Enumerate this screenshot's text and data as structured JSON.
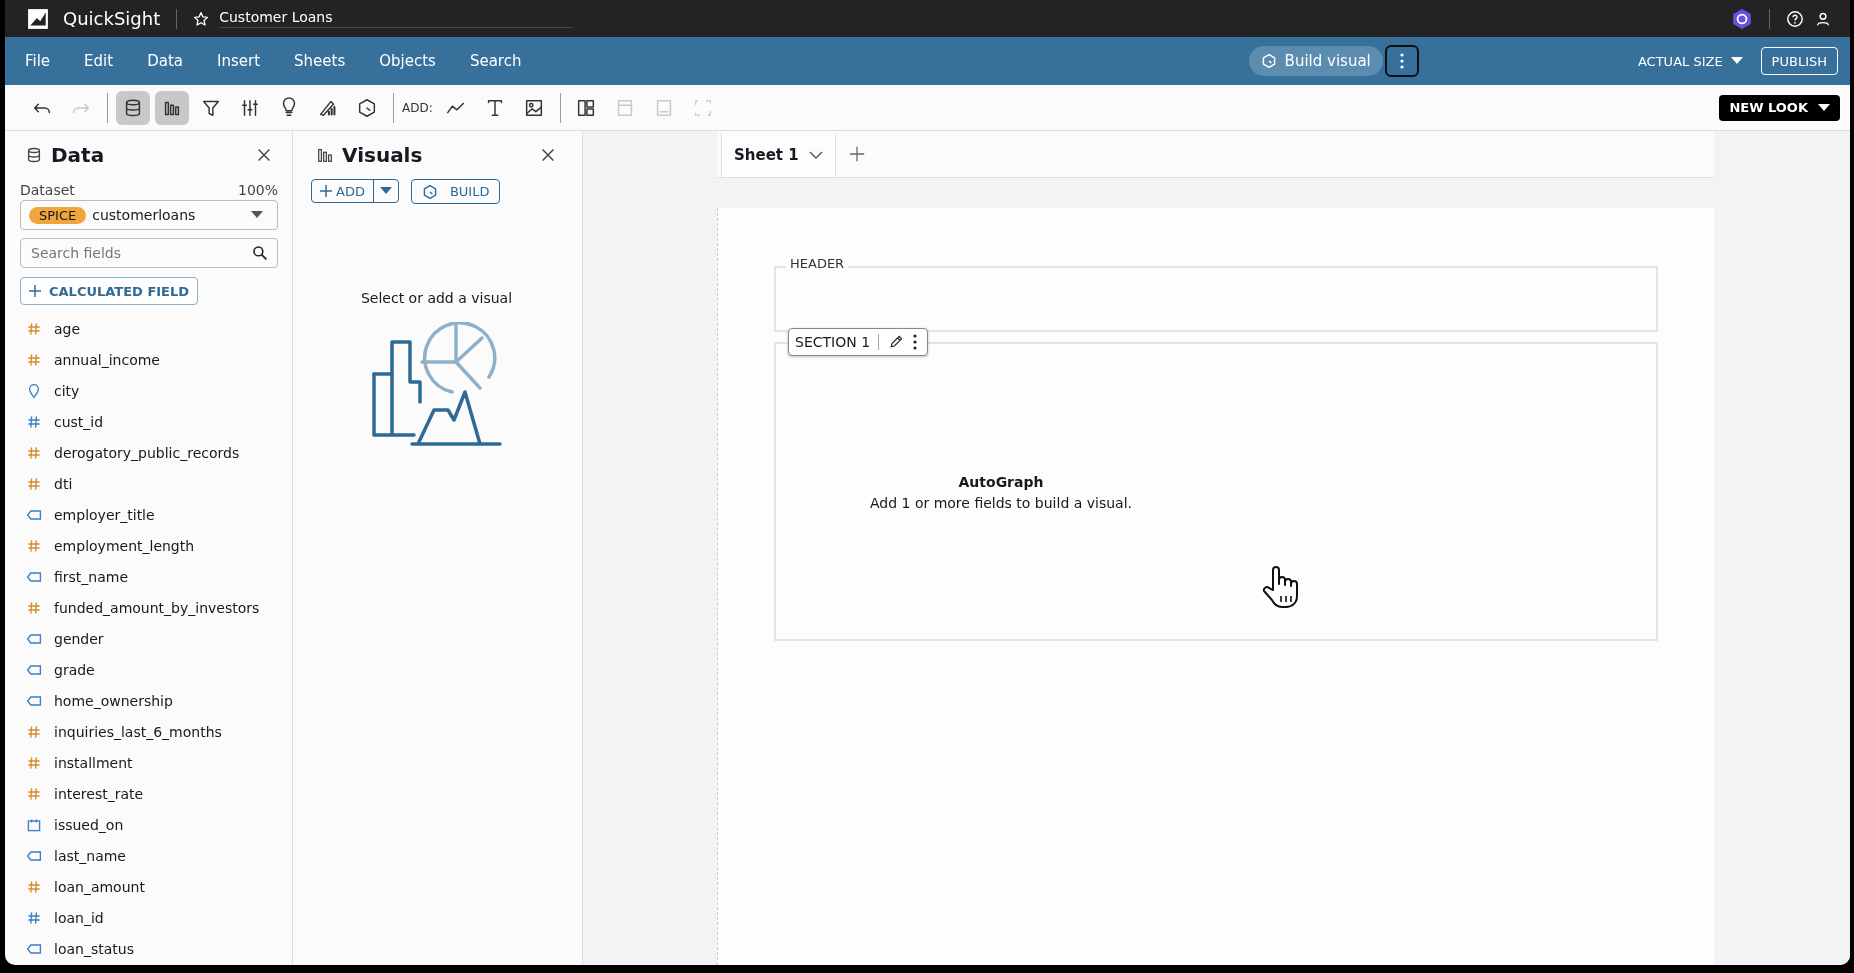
{
  "app": {
    "name": "QuickSight",
    "analysis_title": "Customer Loans"
  },
  "menu": [
    "File",
    "Edit",
    "Data",
    "Insert",
    "Sheets",
    "Objects",
    "Search"
  ],
  "build_visual": "Build visual",
  "actual_size": "ACTUAL SIZE",
  "publish": "PUBLISH",
  "toolbar": [
    {
      "kind": "undo",
      "selected": false,
      "disabled": false
    },
    {
      "kind": "redo",
      "selected": false,
      "disabled": true
    },
    {
      "kind": "sep"
    },
    {
      "kind": "data",
      "selected": true,
      "disabled": false
    },
    {
      "kind": "visuals",
      "selected": true,
      "disabled": false
    },
    {
      "kind": "filter",
      "selected": false,
      "disabled": false
    },
    {
      "kind": "controls",
      "selected": false,
      "disabled": false
    },
    {
      "kind": "insights",
      "selected": false,
      "disabled": false
    },
    {
      "kind": "forecast",
      "selected": false,
      "disabled": false
    },
    {
      "kind": "autograph",
      "selected": false,
      "disabled": false
    },
    {
      "kind": "sep"
    },
    {
      "kind": "label",
      "text": "ADD:"
    },
    {
      "kind": "line",
      "selected": false,
      "disabled": false
    },
    {
      "kind": "text",
      "selected": false,
      "disabled": false
    },
    {
      "kind": "image",
      "selected": false,
      "disabled": false
    },
    {
      "kind": "sep"
    },
    {
      "kind": "layout",
      "selected": false,
      "disabled": false
    },
    {
      "kind": "header",
      "selected": false,
      "disabled": true
    },
    {
      "kind": "footer",
      "selected": false,
      "disabled": true
    },
    {
      "kind": "fit",
      "selected": false,
      "disabled": true
    }
  ],
  "new_look": "NEW LOOK",
  "data_panel": {
    "title": "Data",
    "dataset_label": "Dataset",
    "dataset_percent": "100%",
    "badge": "SPICE",
    "dataset": "customerloans",
    "search": {
      "placeholder": "Search fields"
    },
    "calculated_field": "CALCULATED FIELD",
    "fields": [
      {
        "name": "age",
        "kind": "measure"
      },
      {
        "name": "annual_income",
        "kind": "measure"
      },
      {
        "name": "city",
        "kind": "geo"
      },
      {
        "name": "cust_id",
        "kind": "number_dimension"
      },
      {
        "name": "derogatory_public_records",
        "kind": "measure"
      },
      {
        "name": "dti",
        "kind": "measure"
      },
      {
        "name": "employer_title",
        "kind": "text"
      },
      {
        "name": "employment_length",
        "kind": "measure"
      },
      {
        "name": "first_name",
        "kind": "text"
      },
      {
        "name": "funded_amount_by_investors",
        "kind": "measure"
      },
      {
        "name": "gender",
        "kind": "text"
      },
      {
        "name": "grade",
        "kind": "text"
      },
      {
        "name": "home_ownership",
        "kind": "text"
      },
      {
        "name": "inquiries_last_6_months",
        "kind": "measure"
      },
      {
        "name": "installment",
        "kind": "measure"
      },
      {
        "name": "interest_rate",
        "kind": "measure"
      },
      {
        "name": "issued_on",
        "kind": "date"
      },
      {
        "name": "last_name",
        "kind": "text"
      },
      {
        "name": "loan_amount",
        "kind": "measure"
      },
      {
        "name": "loan_id",
        "kind": "number_dimension"
      },
      {
        "name": "loan_status",
        "kind": "text"
      }
    ]
  },
  "visuals_panel": {
    "title": "Visuals",
    "add": "ADD",
    "build": "BUILD",
    "empty_text": "Select or add a visual"
  },
  "sheets": [
    {
      "label": "Sheet 1",
      "selected": true
    }
  ],
  "sheet": {
    "header_label": "HEADER",
    "section_label": "SECTION 1",
    "autograph_title": "AutoGraph",
    "autograph_text": "Add 1 or more fields to build a visual."
  }
}
